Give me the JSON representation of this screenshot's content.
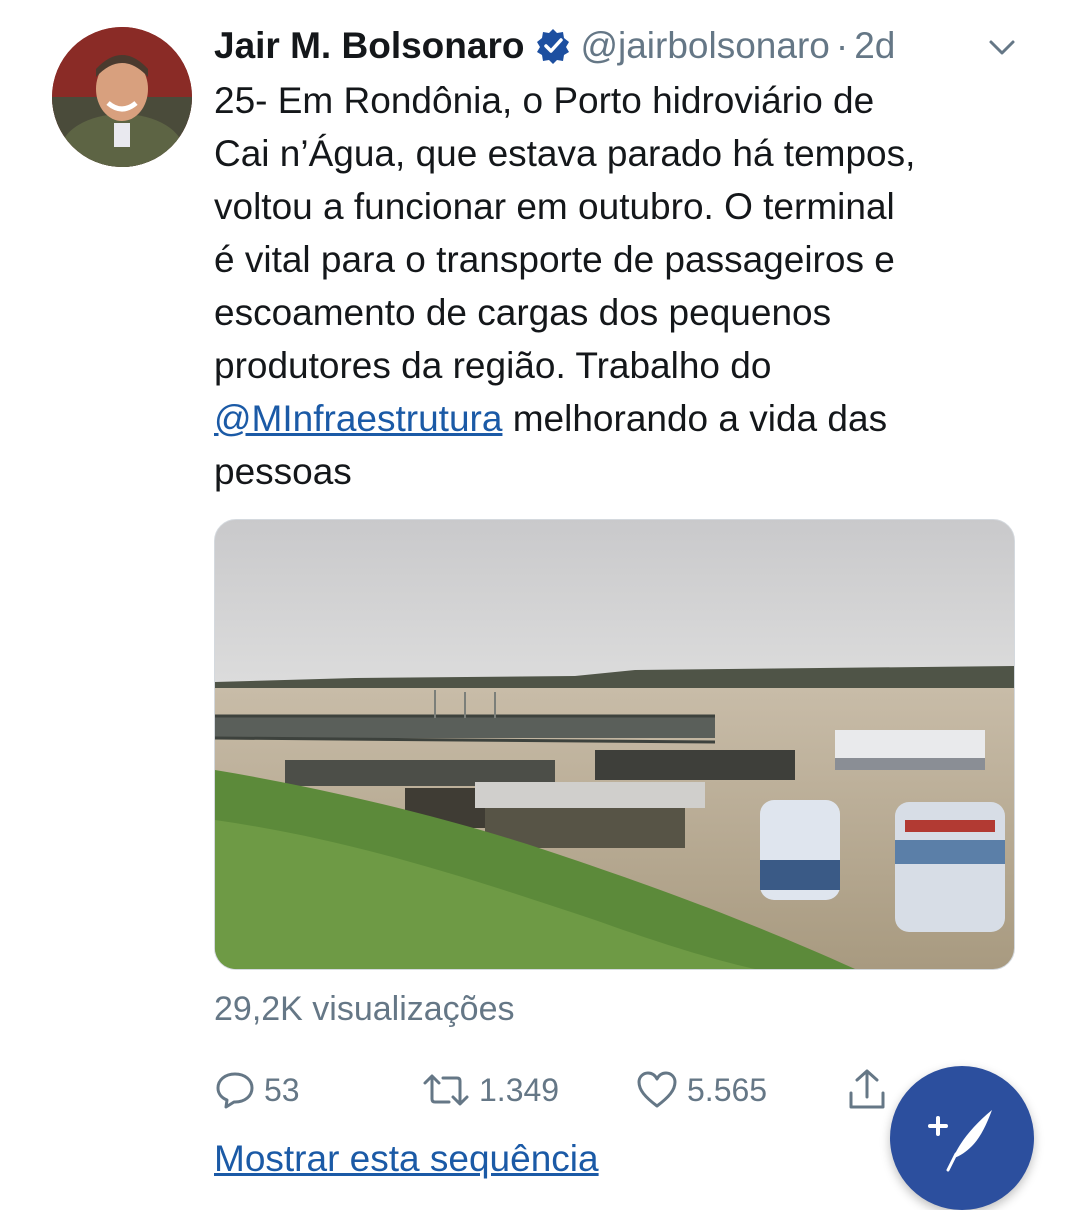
{
  "tweet": {
    "author_name": "Jair M. Bolsonaro",
    "handle": "@jairbolsonaro",
    "separator": "·",
    "time": "2d",
    "text_before_mention": "25- Em Rondônia, o Porto hidroviário de\nCai n’Água, que estava parado há tempos,\nvoltou a funcionar em outubro. O terminal\né vital para o transporte de passageiros e\nescoamento de cargas dos pequenos\nprodutores da região. Trabalho do\n",
    "mention": "@MInfraestrutura",
    "text_after_mention": " melhorando a vida das\npessoas",
    "views": "29,2K visualizações",
    "replies": "53",
    "retweets": "1.349",
    "likes": "5.565",
    "show_thread": "Mostrar esta sequência"
  },
  "colors": {
    "link": "#1b5aa6",
    "muted": "#657786",
    "verified": "#1d4fa0",
    "fab": "#2c4f9e"
  },
  "icons": {
    "verified": "verified-badge-icon",
    "caret": "chevron-down-icon",
    "reply": "reply-icon",
    "retweet": "retweet-icon",
    "like": "heart-icon",
    "share": "share-icon",
    "compose": "compose-tweet-icon"
  }
}
